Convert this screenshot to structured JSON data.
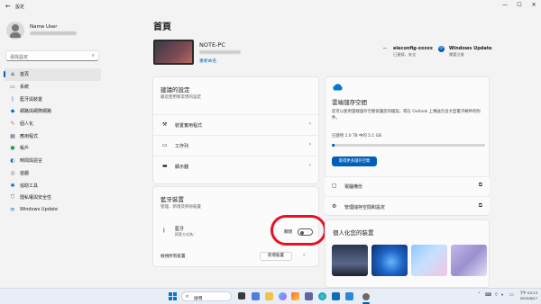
{
  "window": {
    "title": "設定",
    "back_icon": "back-arrow-icon",
    "controls": [
      "minimize-icon",
      "maximize-icon",
      "close-icon"
    ]
  },
  "sidebar": {
    "user_name": "Name User",
    "search_placeholder": "尋找設定",
    "items": [
      {
        "label": "首頁",
        "icon": "home-icon"
      },
      {
        "label": "系統",
        "icon": "monitor-icon"
      },
      {
        "label": "藍牙與裝置",
        "icon": "bluetooth-icon"
      },
      {
        "label": "網路與網際網路",
        "icon": "wifi-icon"
      },
      {
        "label": "個人化",
        "icon": "brush-icon"
      },
      {
        "label": "應用程式",
        "icon": "apps-icon"
      },
      {
        "label": "帳戶",
        "icon": "person-icon"
      },
      {
        "label": "時間與語言",
        "icon": "globe-clock-icon"
      },
      {
        "label": "遊戲",
        "icon": "gamepad-icon"
      },
      {
        "label": "協助工具",
        "icon": "accessibility-icon"
      },
      {
        "label": "隱私權與安全性",
        "icon": "shield-icon"
      },
      {
        "label": "Windows Update",
        "icon": "update-icon"
      }
    ]
  },
  "main": {
    "page_title": "首頁",
    "device": {
      "name": "NOTE-PC",
      "rename_link": "重新命名"
    },
    "status": {
      "network": {
        "name": "eleconfig-xxxxx",
        "detail": "已連線，安全"
      },
      "update": {
        "name": "Windows Update",
        "detail": "需要注意"
      }
    },
    "recommended": {
      "title": "建議的設定",
      "subtitle": "最近使用和常用的設定",
      "items": [
        {
          "label": "裝置實用程式",
          "icon": "tools-icon"
        },
        {
          "label": "工作列",
          "icon": "taskbar-icon"
        },
        {
          "label": "顯示器",
          "icon": "display-icon"
        }
      ]
    },
    "bluetooth": {
      "title": "藍牙裝置",
      "subtitle": "管理、新增及移除裝置",
      "item_title": "藍牙",
      "item_detail": "探索方式為：",
      "toggle_label": "關閉",
      "toggle_state": "off",
      "view_all": "檢視所有裝置",
      "add_button": "新增裝置"
    },
    "cloud": {
      "title": "雲端儲存空間",
      "description": "您可以使用雲端儲存空間保護您的檔案，或在 Outlook 上傳送包含大型電子郵件的附件。",
      "usage_text": "已使用 1.0 TB 中的 5.1 GB",
      "usage_value": "5.1 GB",
      "usage_fraction": 0.005,
      "more_button": "取得更多儲存空間",
      "rows": [
        {
          "label": "電腦備份",
          "icon": "backup-icon"
        },
        {
          "label": "管理儲存空間和設定",
          "icon": "gear-icon"
        }
      ]
    },
    "personalize": {
      "title": "個人化您的裝置"
    }
  },
  "taskbar": {
    "search_label": "搜尋",
    "time": "下午 03:13",
    "date": "2025/6/27"
  },
  "colors": {
    "accent": "#005fb8",
    "highlight_ring": "#e81123",
    "background": "#f3f3f3",
    "card": "#fbfbfb"
  }
}
